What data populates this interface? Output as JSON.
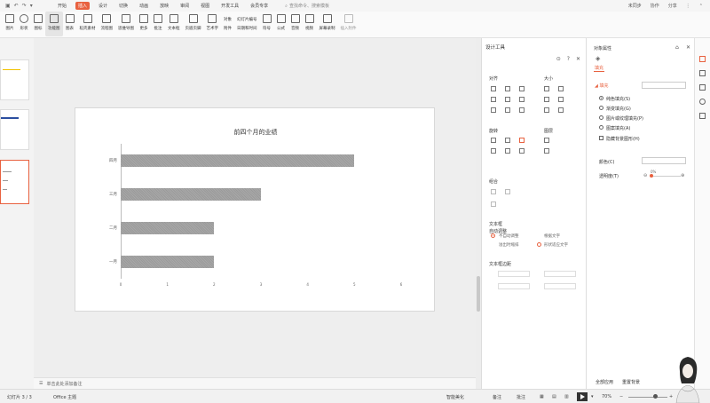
{
  "menubar": {
    "items": [
      "开始",
      "插入",
      "设计",
      "切换",
      "动画",
      "放映",
      "审阅",
      "视图",
      "开发工具",
      "会员专享"
    ],
    "active_index": 1,
    "search_placeholder": "查找命令、搜索模板",
    "right": [
      "未同步",
      "协作",
      "分享"
    ]
  },
  "ribbon": {
    "items": [
      "图片",
      "形状",
      "图标",
      "功能图",
      "图表",
      "稻壳素材",
      "流程图",
      "思维导图",
      "更多",
      "批注",
      "文本框",
      "页眉页脚",
      "艺术字",
      "符号",
      "公式",
      "音频",
      "视频",
      "屏幕录制",
      "插入附件",
      "幻灯片编号",
      "对象",
      "日期和时间",
      "附件"
    ]
  },
  "chart_data": {
    "type": "bar",
    "title": "前四个月的业绩",
    "categories": [
      "一月",
      "二月",
      "三月",
      "四月"
    ],
    "values": [
      2,
      2,
      3,
      5
    ],
    "xticks": [
      "0",
      "1",
      "2",
      "3",
      "4",
      "5",
      "6"
    ],
    "xlim": [
      0,
      6
    ],
    "orientation": "horizontal",
    "color": "#a0a0a0"
  },
  "notes": {
    "placeholder": "单击此处添加备注"
  },
  "design_panel": {
    "title": "设计工具",
    "align_label": "对齐",
    "size_label": "大小",
    "rotate_label": "旋转",
    "distribute_label": "图层",
    "group_label": "组合",
    "textbox_label": "文本框",
    "autofit_label": "自动调整",
    "option_a": "不自动调整",
    "option_b": "根据文字",
    "option_c": "溢出时缩排",
    "option_d": "形状适应文字",
    "margin_label": "文本框边距"
  },
  "prop_panel": {
    "title": "对象属性",
    "tab": "填充",
    "section": "填充",
    "fill_options": [
      "纯色填充(S)",
      "渐变填充(G)",
      "图片或纹理填充(P)",
      "图案填充(A)",
      "隐藏背景图形(H)"
    ],
    "color_label": "颜色(C)",
    "transparency_label": "透明度(T)",
    "transparency_value": "0%",
    "footer": [
      "全部应用",
      "重置背景"
    ]
  },
  "status": {
    "slide_info": "幻灯片 3 / 3",
    "theme": "Office 主题",
    "smart": "智能美化",
    "notes": "备注",
    "comments": "批注",
    "zoom": "70%"
  },
  "colors": {
    "accent": "#e8613f",
    "bar": "#a0a0a0"
  }
}
